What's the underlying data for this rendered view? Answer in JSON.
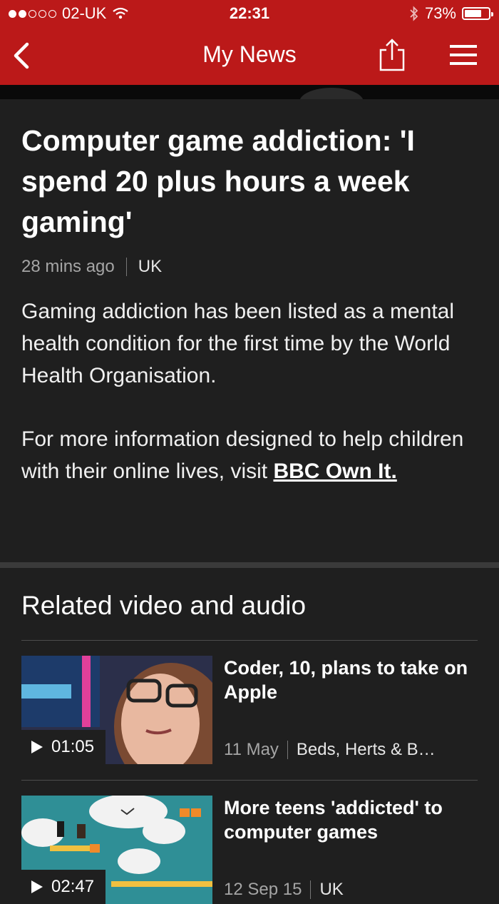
{
  "status_bar": {
    "carrier": "02-UK",
    "time": "22:31",
    "battery": "73%",
    "battery_level": 0.73
  },
  "nav": {
    "title": "My News",
    "back_icon": "chevron-left-icon",
    "share_icon": "share-icon",
    "menu_icon": "hamburger-menu-icon"
  },
  "article": {
    "headline": "Computer game addiction: 'I spend 20 plus hours a week gaming'",
    "time_ago": "28 mins ago",
    "category": "UK",
    "paragraph1": "Gaming addiction has been listed as a mental health condition for the first time by the World Health Organisation.",
    "paragraph2_prefix": "For more information designed to help children with their online lives, visit ",
    "paragraph2_link": "BBC Own It."
  },
  "related": {
    "heading": "Related video and audio",
    "items": [
      {
        "title": "Coder, 10, plans to take on Apple",
        "duration": "01:05",
        "date": "11 May",
        "category": "Beds, Herts & B…"
      },
      {
        "title": "More teens 'addicted' to computer games",
        "duration": "02:47",
        "date": "12 Sep 15",
        "category": "UK"
      }
    ]
  },
  "colors": {
    "brand_red": "#bb1919",
    "background": "#1f1f1f"
  }
}
